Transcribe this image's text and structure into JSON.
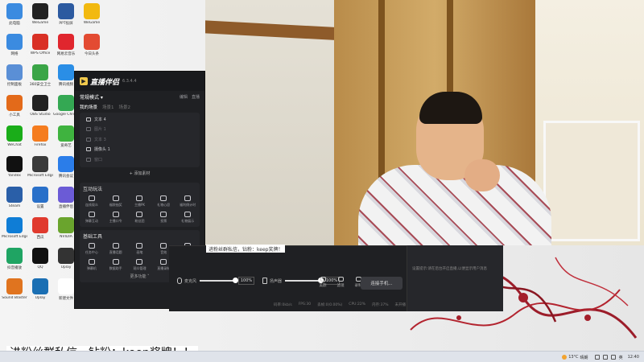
{
  "desktop": {
    "icons": [
      {
        "label": "此电脑",
        "icon": "computer-icon",
        "color": "#3b8be0"
      },
      {
        "label": "WeGame",
        "icon": "wegame-icon",
        "color": "#222222"
      },
      {
        "label": "PPT投屏",
        "icon": "ppt-icon",
        "color": "#2c5aa0"
      },
      {
        "label": "WeGame",
        "icon": "game-icon",
        "color": "#f2b90f"
      },
      {
        "label": "网络",
        "icon": "network-icon",
        "color": "#3b8be0"
      },
      {
        "label": "WPS Office",
        "icon": "wps-icon",
        "color": "#d93025"
      },
      {
        "label": "网易云音乐",
        "icon": "music-icon",
        "color": "#e0262e"
      },
      {
        "label": "今日头条",
        "icon": "news-icon",
        "color": "#e34b32"
      },
      {
        "label": "控制面板",
        "icon": "control-icon",
        "color": "#5a8fd6"
      },
      {
        "label": "360安全卫士",
        "icon": "shield-icon",
        "color": "#3aa547"
      },
      {
        "label": "腾讯视频",
        "icon": "video-icon",
        "color": "#2a8ee6"
      },
      {
        "label": "",
        "icon": "blank-icon",
        "color": "#e0e0e0"
      },
      {
        "label": "小工具",
        "icon": "toolbox-icon",
        "color": "#e36a1a"
      },
      {
        "label": "OBS Studio",
        "icon": "obs-icon",
        "color": "#222222"
      },
      {
        "label": "Google Chrome",
        "icon": "chrome-icon",
        "color": "#34a853"
      },
      {
        "label": "",
        "icon": "blank-icon",
        "color": "#e0e0e0"
      },
      {
        "label": "WeChat",
        "icon": "wechat-icon",
        "color": "#1aad19"
      },
      {
        "label": "Firefox",
        "icon": "firefox-icon",
        "color": "#f57c1f"
      },
      {
        "label": "爱奇艺",
        "icon": "iqiyi-icon",
        "color": "#3fb33f"
      },
      {
        "label": "",
        "icon": "blank-icon",
        "color": "#e0e0e0"
      },
      {
        "label": "Yandex",
        "icon": "yandex-icon",
        "color": "#111111"
      },
      {
        "label": "Microsoft Edge",
        "icon": "edge-icon",
        "color": "#3a3a3a"
      },
      {
        "label": "腾讯会议",
        "icon": "meeting-icon",
        "color": "#2b7de9"
      },
      {
        "label": "",
        "icon": "blank-icon",
        "color": "#e0e0e0"
      },
      {
        "label": "Steam",
        "icon": "steam-icon",
        "color": "#2a5fa8"
      },
      {
        "label": "设置",
        "icon": "settings-icon",
        "color": "#2970c9"
      },
      {
        "label": "直播伴侣",
        "icon": "live-icon",
        "color": "#6b5bd6"
      },
      {
        "label": "",
        "icon": "blank-icon",
        "color": "#e0e0e0"
      },
      {
        "label": "Microsoft Edge",
        "icon": "edge2-icon",
        "color": "#0f7dd6"
      },
      {
        "label": "西瓜",
        "icon": "melon-icon",
        "color": "#e03a2e"
      },
      {
        "label": "NVIDIA",
        "icon": "nvidia-icon",
        "color": "#6aa42d"
      },
      {
        "label": "",
        "icon": "blank-icon",
        "color": "#e0e0e0"
      },
      {
        "label": "抖音播放",
        "icon": "play-icon",
        "color": "#1fa463"
      },
      {
        "label": "QQ",
        "icon": "qq-icon",
        "color": "#111111"
      },
      {
        "label": "Uplay",
        "icon": "uplay-icon",
        "color": "#333333"
      },
      {
        "label": "",
        "icon": "blank-icon",
        "color": "#e0e0e0"
      },
      {
        "label": "Sound Blaster",
        "icon": "sound-icon",
        "color": "#e0741f"
      },
      {
        "label": "Uplay",
        "icon": "uplay2-icon",
        "color": "#1b6fb3"
      },
      {
        "label": "新建文件",
        "icon": "file-icon",
        "color": "#ffffff"
      },
      {
        "label": "",
        "icon": "blank-icon",
        "color": "#e0e0e0"
      }
    ]
  },
  "app": {
    "title": "直播伴侣",
    "version": "6.3.4.4",
    "mode_label": "常规模式 ▾",
    "edit_link": "编辑",
    "template_link": "直播",
    "scene_tabs": [
      "我的场景",
      "场景1",
      "场景2"
    ],
    "sources": [
      {
        "label": "文本 4",
        "dim": false
      },
      {
        "label": "图片 1",
        "dim": true
      },
      {
        "label": "文本 3",
        "dim": true
      },
      {
        "label": "摄像头 1",
        "dim": false
      },
      {
        "label": "窗口",
        "dim": true
      }
    ],
    "add_source": "+ 添加素材",
    "interactive_title": "互动玩法",
    "interactive_tools": [
      "连线观众",
      "福袋抽奖",
      "主播PK",
      "礼物心愿",
      "福利倒计时",
      "弹幕互动",
      "主播口令",
      "粉丝团",
      "投票",
      "礼物展示"
    ],
    "basic_title": "基础工具",
    "basic_tools": [
      "任务中心",
      "直播话题",
      "画笔",
      "音效",
      "正在直播",
      "弹幕机",
      "数据助手",
      "观众管理",
      "直播录制",
      "下播总结"
    ],
    "more_label": "更多功能 ˅"
  },
  "controls": {
    "mic_label": "麦克风",
    "mic_volume": "100%",
    "mic_level": 1.0,
    "speaker_label": "扬声器",
    "speaker_volume": "100%",
    "speaker_level": 1.0,
    "buttons": [
      "美颜",
      "滤镜",
      "录制",
      "设置"
    ],
    "go_live": "连接手机...",
    "stats": [
      "码率:0kb/s",
      "FPS:30",
      "丢帧:0(0.00%)",
      "CPU:22%",
      "内存:37%",
      "未开播"
    ]
  },
  "chat_panel": {
    "hint": "设置提示:请在后台开启直播,以便显示用户消息"
  },
  "ticker": {
    "top_text": "进粉丝群私信，钻粉：keep奖牌！",
    "bottom_text": "进粉丝群私信，钻粉：keep奖牌！！"
  },
  "taskbar": {
    "temperature": "13°C",
    "weather": "晴朗",
    "lang": "英",
    "clock": "12:40"
  }
}
